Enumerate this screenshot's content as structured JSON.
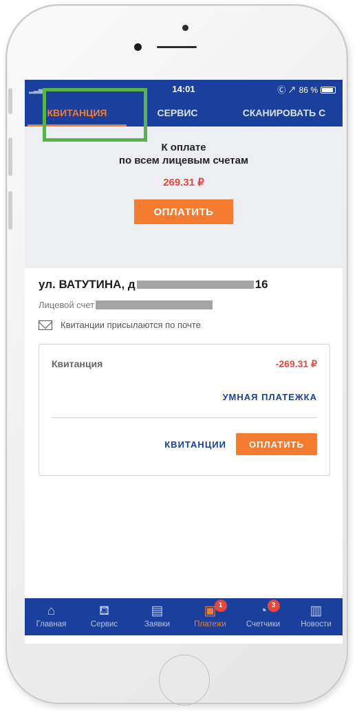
{
  "status": {
    "time": "14:01",
    "battery": "86 %",
    "indicators": "Ⓒ ↗"
  },
  "tabs": [
    {
      "label": "КВИТАНЦИЯ",
      "active": true
    },
    {
      "label": "СЕРВИС",
      "active": false
    },
    {
      "label": "СКАНИРОВАТЬ С",
      "active": false
    }
  ],
  "summary": {
    "line1": "К оплате",
    "line2": "по всем лицевым счетам",
    "amount": "269.31 ₽",
    "pay_button": "ОПЛАТИТЬ"
  },
  "account": {
    "address": "ул. ВАТУТИНА, д",
    "address_tail": "16",
    "account_label": "Лицевой счет",
    "mail_note": "Квитанции присылаются по почте"
  },
  "card": {
    "label": "Квитанция",
    "amount": "-269.31 ₽",
    "smart_payment": "УМНАЯ ПЛАТЕЖКА",
    "receipts_button": "КВИТАНЦИИ",
    "pay_button": "ОПЛАТИТЬ"
  },
  "bottom_nav": [
    {
      "label": "Главная",
      "icon": "home-icon",
      "active": false,
      "badge": ""
    },
    {
      "label": "Сервис",
      "icon": "basket-icon",
      "active": false,
      "badge": ""
    },
    {
      "label": "Заявки",
      "icon": "requests-icon",
      "active": false,
      "badge": ""
    },
    {
      "label": "Платежи",
      "icon": "payments-icon",
      "active": true,
      "badge": "1"
    },
    {
      "label": "Счетчики",
      "icon": "meters-icon",
      "active": false,
      "badge": "3"
    },
    {
      "label": "Новости",
      "icon": "news-icon",
      "active": false,
      "badge": ""
    }
  ],
  "colors": {
    "primary": "#1a3f9c",
    "accent": "#f47c30",
    "price": "#e8473d",
    "highlight": "#59b34a"
  }
}
